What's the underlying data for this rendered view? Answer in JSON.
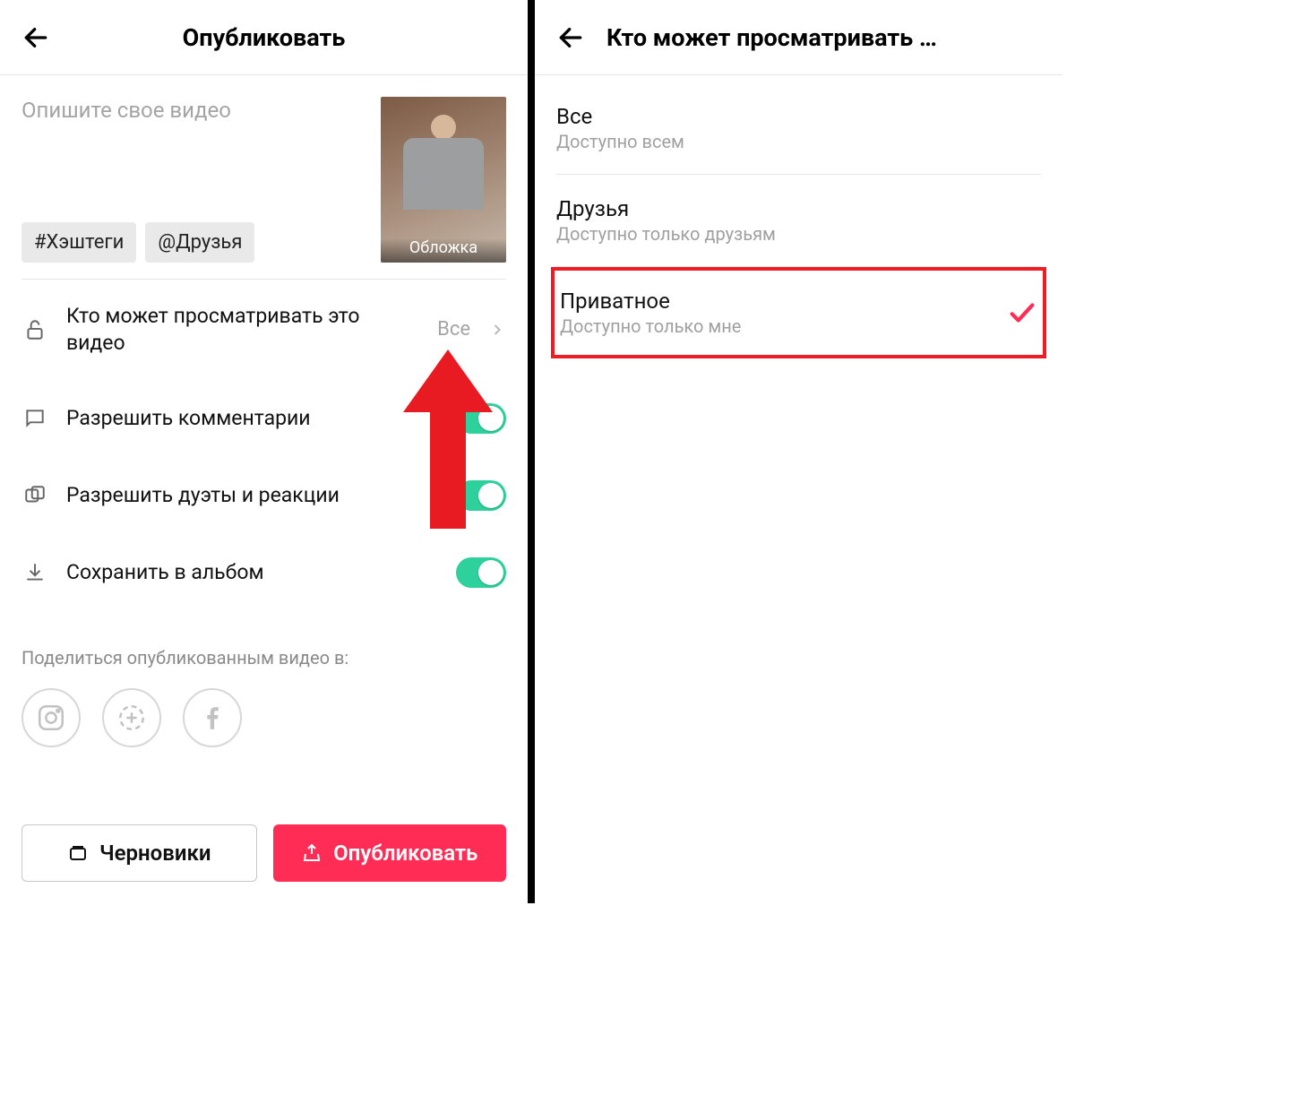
{
  "left": {
    "title": "Опубликовать",
    "caption_placeholder": "Опишите свое видео",
    "chips": {
      "hashtags": "#Хэштеги",
      "friends": "@Друзья"
    },
    "cover_label": "Обложка",
    "settings": {
      "visibility_label": "Кто может просматривать это видео",
      "visibility_value": "Все",
      "comments_label": "Разрешить комментарии",
      "duets_label": "Разрешить дуэты и реакции",
      "save_label": "Сохранить в альбом"
    },
    "share_label": "Поделиться опубликованным видео в:",
    "buttons": {
      "drafts": "Черновики",
      "publish": "Опубликовать"
    }
  },
  "right": {
    "title": "Кто может просматривать …",
    "options": [
      {
        "title": "Все",
        "sub": "Доступно всем",
        "selected": false,
        "highlighted": false
      },
      {
        "title": "Друзья",
        "sub": "Доступно только друзьям",
        "selected": false,
        "highlighted": false
      },
      {
        "title": "Приватное",
        "sub": "Доступно только мне",
        "selected": true,
        "highlighted": true
      }
    ]
  }
}
